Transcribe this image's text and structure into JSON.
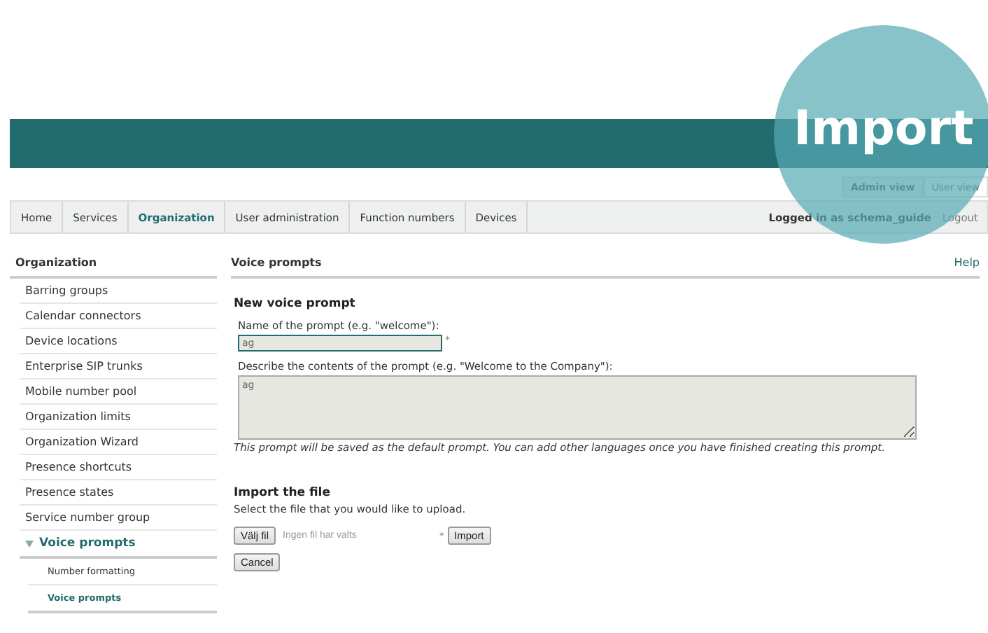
{
  "callout": {
    "text": "Import"
  },
  "view_switch": [
    {
      "label": "Admin view",
      "selected": true
    },
    {
      "label": "User view",
      "selected": false
    }
  ],
  "nav": {
    "items": [
      {
        "label": "Home",
        "selected": false
      },
      {
        "label": "Services",
        "selected": false
      },
      {
        "label": "Organization",
        "selected": true
      },
      {
        "label": "User administration",
        "selected": false
      },
      {
        "label": "Function numbers",
        "selected": false
      },
      {
        "label": "Devices",
        "selected": false
      }
    ],
    "user": "Logged in as schema_guide",
    "logout": "Logout"
  },
  "sidebar": {
    "title": "Organization",
    "items": [
      {
        "label": "Barring groups",
        "expanded": false
      },
      {
        "label": "Calendar connectors",
        "expanded": false
      },
      {
        "label": "Device locations",
        "expanded": false
      },
      {
        "label": "Enterprise SIP trunks",
        "expanded": false
      },
      {
        "label": "Mobile number pool",
        "expanded": false
      },
      {
        "label": "Organization limits",
        "expanded": false
      },
      {
        "label": "Organization Wizard",
        "expanded": false
      },
      {
        "label": "Presence shortcuts",
        "expanded": false
      },
      {
        "label": "Presence states",
        "expanded": false
      },
      {
        "label": "Service number group",
        "expanded": false
      },
      {
        "label": "Voice prompts",
        "expanded": true,
        "children": [
          {
            "label": "Number formatting",
            "selected": false
          },
          {
            "label": "Voice prompts",
            "selected": true
          }
        ]
      }
    ]
  },
  "content": {
    "title": "Voice prompts",
    "help": "Help",
    "form": {
      "heading": "New voice prompt",
      "name_label": "Name of the prompt (e.g. \"welcome\"):",
      "name_value": "ag",
      "required_mark": "*",
      "description_label": "Describe the contents of the prompt (e.g. \"Welcome to the Company\"):",
      "description_value": "ag",
      "note": "This prompt will be saved as the default prompt. You can add other languages once you have finished creating this prompt."
    },
    "import": {
      "heading": "Import the file",
      "hint": "Select the file that you would like to upload.",
      "choose_button": "Välj fil",
      "file_status": "Ingen fil har valts",
      "required_mark": "*",
      "import_button": "Import",
      "cancel_button": "Cancel"
    }
  }
}
